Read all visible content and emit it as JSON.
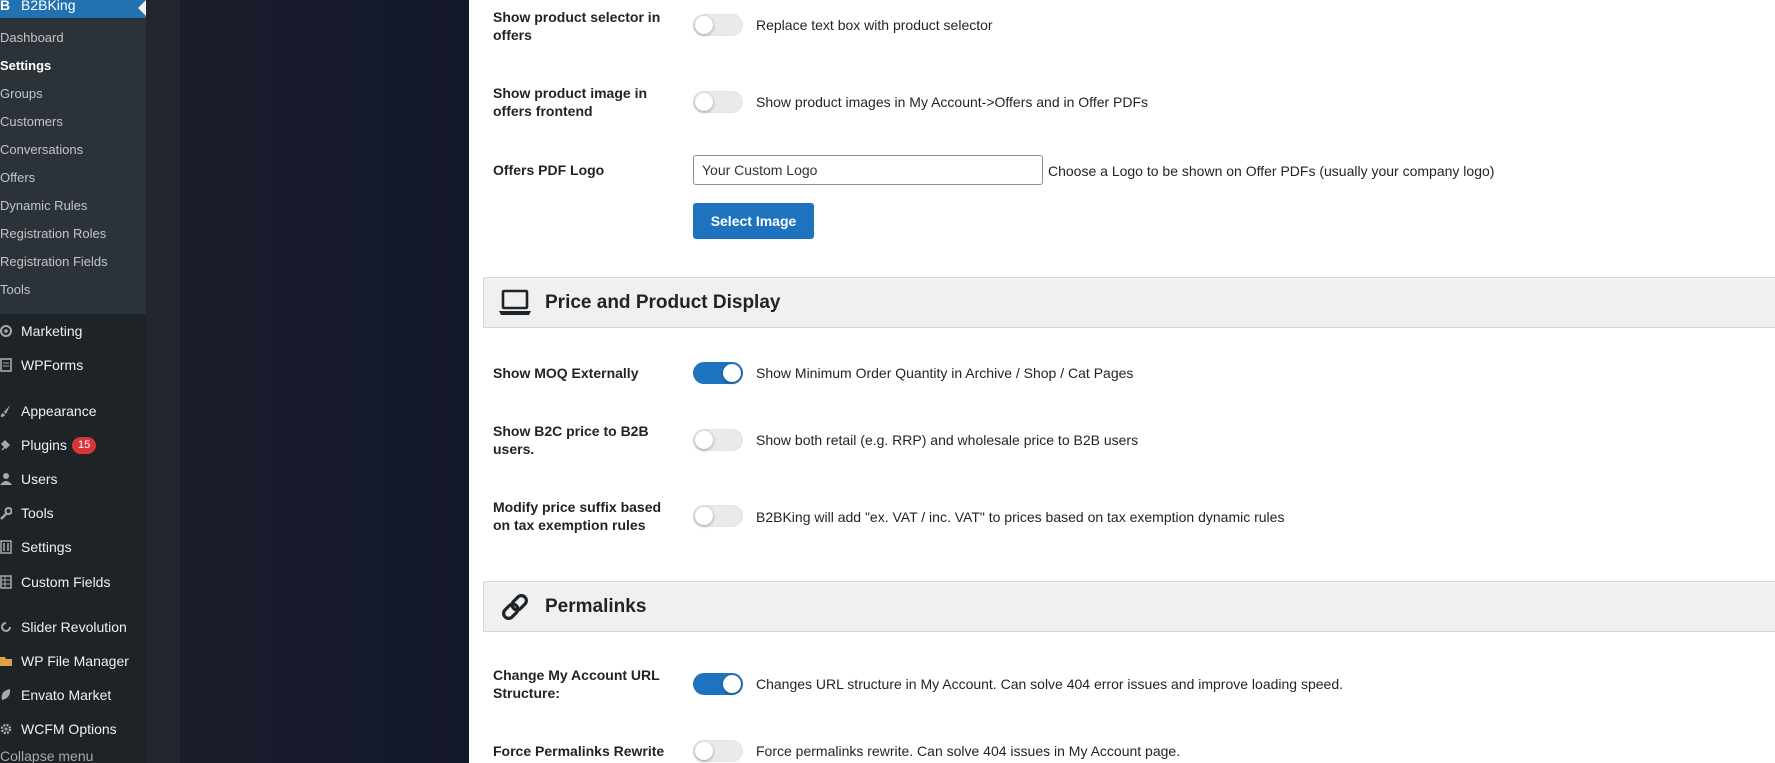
{
  "sidebar": {
    "brand": "B2BKing",
    "submenu": [
      "Dashboard",
      "Settings",
      "Groups",
      "Customers",
      "Conversations",
      "Offers",
      "Dynamic Rules",
      "Registration Roles",
      "Registration Fields",
      "Tools"
    ],
    "active_submenu": "Settings",
    "menu": [
      {
        "label": "Marketing",
        "icon": "megaphone-icon"
      },
      {
        "label": "WPForms",
        "icon": "form-icon"
      },
      {
        "label": "Appearance",
        "icon": "paintbrush-icon"
      },
      {
        "label": "Plugins",
        "icon": "plug-icon",
        "badge": "15"
      },
      {
        "label": "Users",
        "icon": "user-icon"
      },
      {
        "label": "Tools",
        "icon": "wrench-icon"
      },
      {
        "label": "Settings",
        "icon": "sliders-icon"
      },
      {
        "label": "Custom Fields",
        "icon": "table-icon"
      },
      {
        "label": "Slider Revolution",
        "icon": "refresh-icon"
      },
      {
        "label": "WP File Manager",
        "icon": "folder-icon"
      },
      {
        "label": "Envato Market",
        "icon": "leaf-icon"
      },
      {
        "label": "WCFM Options",
        "icon": "gear-icon"
      }
    ],
    "collapse": "Collapse menu"
  },
  "settings": {
    "product_selector": {
      "label": "Show product selector in offers",
      "desc": "Replace text box with product selector",
      "enabled": false
    },
    "product_image": {
      "label": "Show product image in offers frontend",
      "desc": "Show product images in My Account->Offers and in Offer PDFs",
      "enabled": false
    },
    "pdf_logo": {
      "label": "Offers PDF Logo",
      "value": "Your Custom Logo",
      "desc": "Choose a Logo to be shown on Offer PDFs (usually your company logo)",
      "button": "Select Image"
    },
    "price_section": {
      "title": "Price and Product Display",
      "icon": "laptop-icon"
    },
    "moq": {
      "label": "Show MOQ Externally",
      "desc": "Show Minimum Order Quantity in Archive / Shop / Cat Pages",
      "enabled": true
    },
    "b2c_price": {
      "label": "Show B2C price to B2B users.",
      "desc": "Show both retail (e.g. RRP) and wholesale price to B2B users",
      "enabled": false
    },
    "price_suffix": {
      "label": "Modify price suffix based on tax exemption rules",
      "desc": "B2BKing will add \"ex. VAT / inc. VAT\" to prices based on tax exemption dynamic rules",
      "enabled": false
    },
    "permalinks_section": {
      "title": "Permalinks",
      "icon": "link-icon"
    },
    "account_url": {
      "label": "Change My Account URL Structure:",
      "desc": "Changes URL structure in My Account. Can solve 404 error issues and improve loading speed.",
      "enabled": true
    },
    "permalinks_rewrite": {
      "label": "Force Permalinks Rewrite",
      "desc": "Force permalinks rewrite. Can solve 404 issues in My Account page.",
      "enabled": false
    }
  },
  "colors": {
    "accent": "#1e73be",
    "sidebar": "#1d2327",
    "submenu": "#2c3338",
    "badge": "#d63638"
  }
}
